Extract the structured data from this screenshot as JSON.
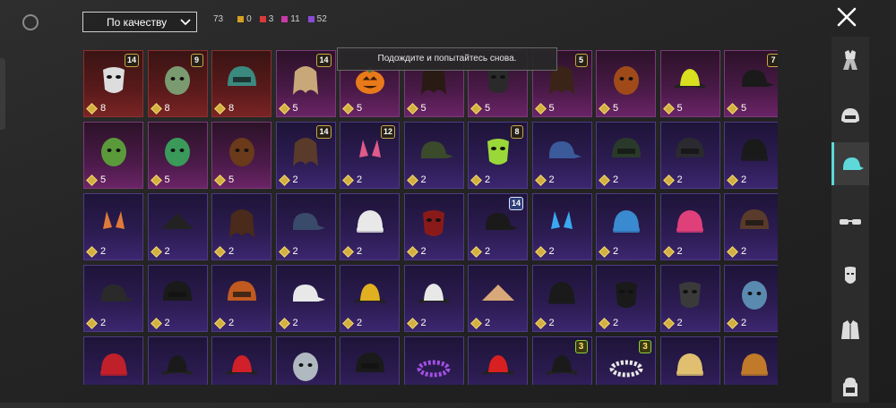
{
  "sort": {
    "label": "По качеству"
  },
  "stats": {
    "total": "73",
    "items": [
      {
        "color": "#d4a020",
        "count": "0"
      },
      {
        "color": "#d83a3a",
        "count": "3"
      },
      {
        "color": "#c83aa8",
        "count": "11"
      },
      {
        "color": "#8a4ad8",
        "count": "52"
      }
    ]
  },
  "toast": {
    "text": "Подождите и попытайтесь снова."
  },
  "sidebar": {
    "items": [
      {
        "icon": "outfit-icon"
      },
      {
        "icon": "helmet-icon"
      },
      {
        "icon": "cap-icon",
        "active": true
      },
      {
        "icon": "glasses-icon"
      },
      {
        "icon": "mask-icon"
      },
      {
        "icon": "jacket-icon"
      },
      {
        "icon": "backpack-icon"
      }
    ]
  },
  "grid": {
    "items": [
      {
        "name": "cat-mask",
        "rarity": "red",
        "value": "8",
        "badge": "14"
      },
      {
        "name": "zombie-head",
        "rarity": "red",
        "value": "8",
        "badge": "9"
      },
      {
        "name": "dragon-helmet",
        "rarity": "red",
        "value": "8"
      },
      {
        "name": "blonde-hair",
        "rarity": "pink",
        "value": "5",
        "badge": "14"
      },
      {
        "name": "pumpkin-head",
        "rarity": "pink",
        "value": "5"
      },
      {
        "name": "dark-hair",
        "rarity": "pink",
        "value": "5"
      },
      {
        "name": "plague-mask",
        "rarity": "pink",
        "value": "5"
      },
      {
        "name": "pigtails-hair",
        "rarity": "pink",
        "value": "5",
        "badge": "5"
      },
      {
        "name": "dino-head",
        "rarity": "pink",
        "value": "5"
      },
      {
        "name": "yellow-bucket-hat",
        "rarity": "pink",
        "value": "5"
      },
      {
        "name": "police-cap",
        "rarity": "pink",
        "value": "5",
        "badge": "7"
      },
      {
        "name": "cowboy-frog",
        "rarity": "pink",
        "value": "5"
      },
      {
        "name": "frog-goggles",
        "rarity": "pink",
        "value": "5"
      },
      {
        "name": "bear-head",
        "rarity": "pink",
        "value": "5"
      },
      {
        "name": "long-hair-cap",
        "rarity": "purple",
        "value": "2",
        "badge": "14"
      },
      {
        "name": "bunny-headband",
        "rarity": "purple",
        "value": "2",
        "badge": "12"
      },
      {
        "name": "military-caps",
        "rarity": "purple",
        "value": "2"
      },
      {
        "name": "skull-hood",
        "rarity": "purple",
        "value": "2",
        "badge": "8"
      },
      {
        "name": "baseball-cap",
        "rarity": "purple",
        "value": "2"
      },
      {
        "name": "gas-mask-helmet",
        "rarity": "purple",
        "value": "2"
      },
      {
        "name": "tactical-helmet",
        "rarity": "purple",
        "value": "2"
      },
      {
        "name": "black-beanie",
        "rarity": "purple",
        "value": "2"
      },
      {
        "name": "cat-ears",
        "rarity": "purple",
        "value": "2"
      },
      {
        "name": "witch-hat",
        "rarity": "purple",
        "value": "2"
      },
      {
        "name": "brown-hair",
        "rarity": "purple",
        "value": "2"
      },
      {
        "name": "navy-cap",
        "rarity": "purple",
        "value": "2"
      },
      {
        "name": "white-turban",
        "rarity": "purple",
        "value": "2"
      },
      {
        "name": "demon-mask",
        "rarity": "purple",
        "value": "2"
      },
      {
        "name": "officer-cap",
        "rarity": "purple",
        "value": "2",
        "badge": "14",
        "badge_style": "blue"
      },
      {
        "name": "blue-bunny-ears",
        "rarity": "purple",
        "value": "2"
      },
      {
        "name": "blue-beanie",
        "rarity": "purple",
        "value": "2"
      },
      {
        "name": "pink-beret",
        "rarity": "purple",
        "value": "2"
      },
      {
        "name": "aviator-cap",
        "rarity": "purple",
        "value": "2"
      },
      {
        "name": "dark-cap",
        "rarity": "purple",
        "value": "2"
      },
      {
        "name": "black-helmet",
        "rarity": "purple",
        "value": "2"
      },
      {
        "name": "football-helmet",
        "rarity": "purple",
        "value": "2"
      },
      {
        "name": "white-visor",
        "rarity": "purple",
        "value": "2"
      },
      {
        "name": "yellow-hat",
        "rarity": "purple",
        "value": "2"
      },
      {
        "name": "feather-hat",
        "rarity": "purple",
        "value": "2"
      },
      {
        "name": "straw-conical-hat",
        "rarity": "purple",
        "value": "2"
      },
      {
        "name": "black-beanie-2",
        "rarity": "purple",
        "value": "2"
      },
      {
        "name": "balaclava",
        "rarity": "purple",
        "value": "2"
      },
      {
        "name": "luchador-mask",
        "rarity": "purple",
        "value": "2"
      },
      {
        "name": "shark-hood",
        "rarity": "purple",
        "value": "2"
      },
      {
        "name": "red-beret",
        "rarity": "purple"
      },
      {
        "name": "black-fedora",
        "rarity": "purple"
      },
      {
        "name": "red-fedora",
        "rarity": "purple"
      },
      {
        "name": "shark-mask",
        "rarity": "purple"
      },
      {
        "name": "headphones",
        "rarity": "purple"
      },
      {
        "name": "purple-flower-crown",
        "rarity": "purple"
      },
      {
        "name": "red-bucket-hat",
        "rarity": "purple"
      },
      {
        "name": "black-trilby",
        "rarity": "purple",
        "badge": "3",
        "badge_style": "green"
      },
      {
        "name": "white-flower-crown",
        "rarity": "purple",
        "badge": "3",
        "badge_style": "green"
      },
      {
        "name": "cake-hat",
        "rarity": "purple"
      },
      {
        "name": "burger-hat",
        "rarity": "purple"
      }
    ]
  }
}
